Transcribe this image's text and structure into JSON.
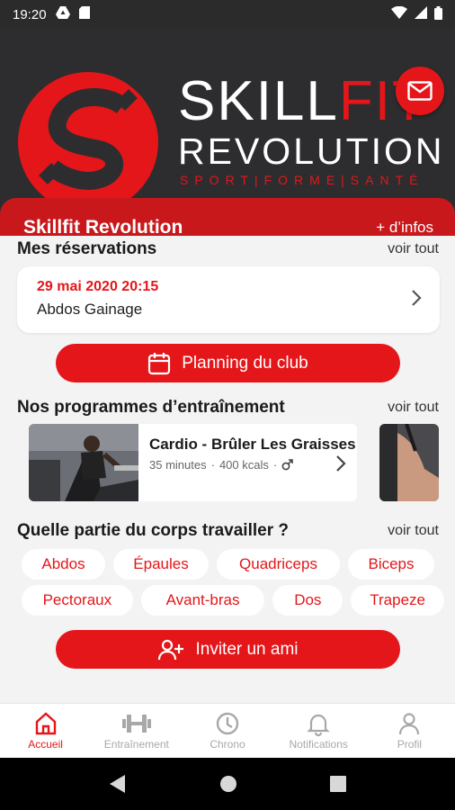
{
  "status_bar": {
    "time": "19:20"
  },
  "brand": {
    "line1_a": "SKILL",
    "line1_b": "FIT",
    "line2": "REVOLUTION",
    "tagline": "SPORT|FORME|SANTÉ"
  },
  "club": {
    "name": "Skillfit Revolution",
    "more_info": "+ d’infos"
  },
  "reservations": {
    "title": "Mes réservations",
    "see_all": "voir tout",
    "item": {
      "date": "29 mai 2020 20:15",
      "label": "Abdos Gainage"
    }
  },
  "planning_button": "Planning du club",
  "programs": {
    "title": "Nos programmes d’entraînement",
    "see_all": "voir tout",
    "item": {
      "title": "Cardio - Brûler Les Graisses",
      "duration": "35 minutes",
      "kcal": "400 kcals"
    }
  },
  "body_parts": {
    "title": "Quelle partie du corps travailler ?",
    "see_all": "voir tout",
    "row1": [
      "Abdos",
      "Épaules",
      "Quadriceps",
      "Biceps"
    ],
    "row2": [
      "Pectoraux",
      "Avant-bras",
      "Dos",
      "Trapeze"
    ]
  },
  "invite_button": "Inviter un ami",
  "bottom_nav": {
    "home": "Accueil",
    "training": "Entraînement",
    "chrono": "Chrono",
    "notifications": "Notifications",
    "profile": "Profil"
  },
  "colors": {
    "accent": "#e4161a",
    "header_bg": "#2d2d2f",
    "club_bar": "#c8181c"
  }
}
